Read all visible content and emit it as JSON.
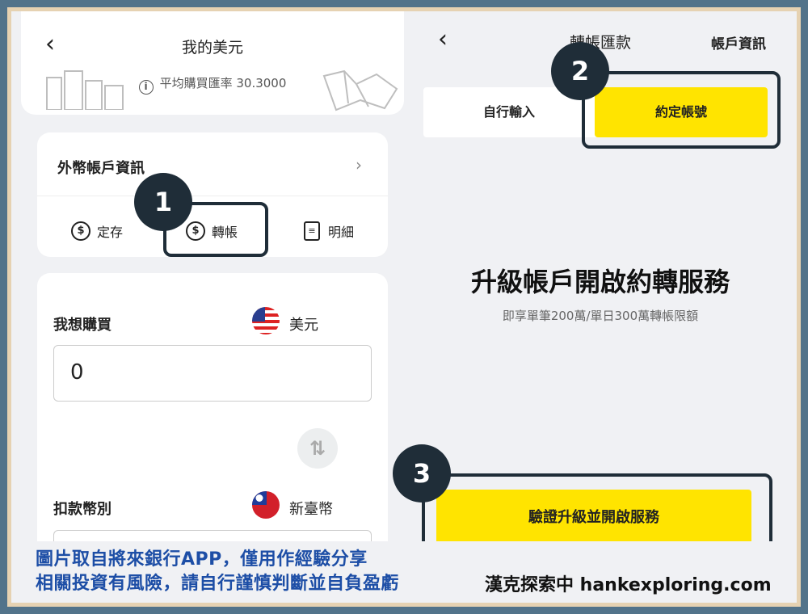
{
  "left": {
    "header": {
      "title": "我的美元",
      "rate_text": "平均購買匯率 30.3000"
    },
    "account_card": {
      "title": "外幣帳戶資訊",
      "actions": [
        {
          "label": "定存",
          "icon": "dollar-circle-icon"
        },
        {
          "label": "轉帳",
          "icon": "transfer-dollar-icon"
        },
        {
          "label": "明細",
          "icon": "document-list-icon"
        }
      ]
    },
    "buy_card": {
      "buy_label": "我想購買",
      "buy_currency": "美元",
      "amount_value": "0",
      "swap_icon": "swap-arrows-icon",
      "swap_glyph": "⇅",
      "debit_label": "扣款幣別",
      "debit_currency": "新臺幣"
    }
  },
  "right": {
    "title": "轉帳匯款",
    "account_info_link": "帳戶資訊",
    "tabs": [
      {
        "label": "自行輸入",
        "selected": false
      },
      {
        "label": "約定帳號",
        "selected": true
      }
    ],
    "headline": "升級帳戶開啟約轉服務",
    "subtext": "即享單筆200萬/單日300萬轉帳限額",
    "cta_label": "驗證升級並開啟服務"
  },
  "annotations": [
    {
      "number": "1"
    },
    {
      "number": "2"
    },
    {
      "number": "3"
    }
  ],
  "footer": {
    "line1": "圖片取自將來銀行APP，僅用作經驗分享",
    "line2": "相關投資有風險，請自行謹慎判斷並自負盈虧",
    "credit": "漢克探索中 hankexploring.com"
  },
  "colors": {
    "accent_yellow": "#ffe400",
    "annotation_dark": "#1f2d38",
    "frame_blue": "#52738a",
    "frame_beige": "#e6d2b2",
    "footer_blue": "#1d4ea6"
  }
}
